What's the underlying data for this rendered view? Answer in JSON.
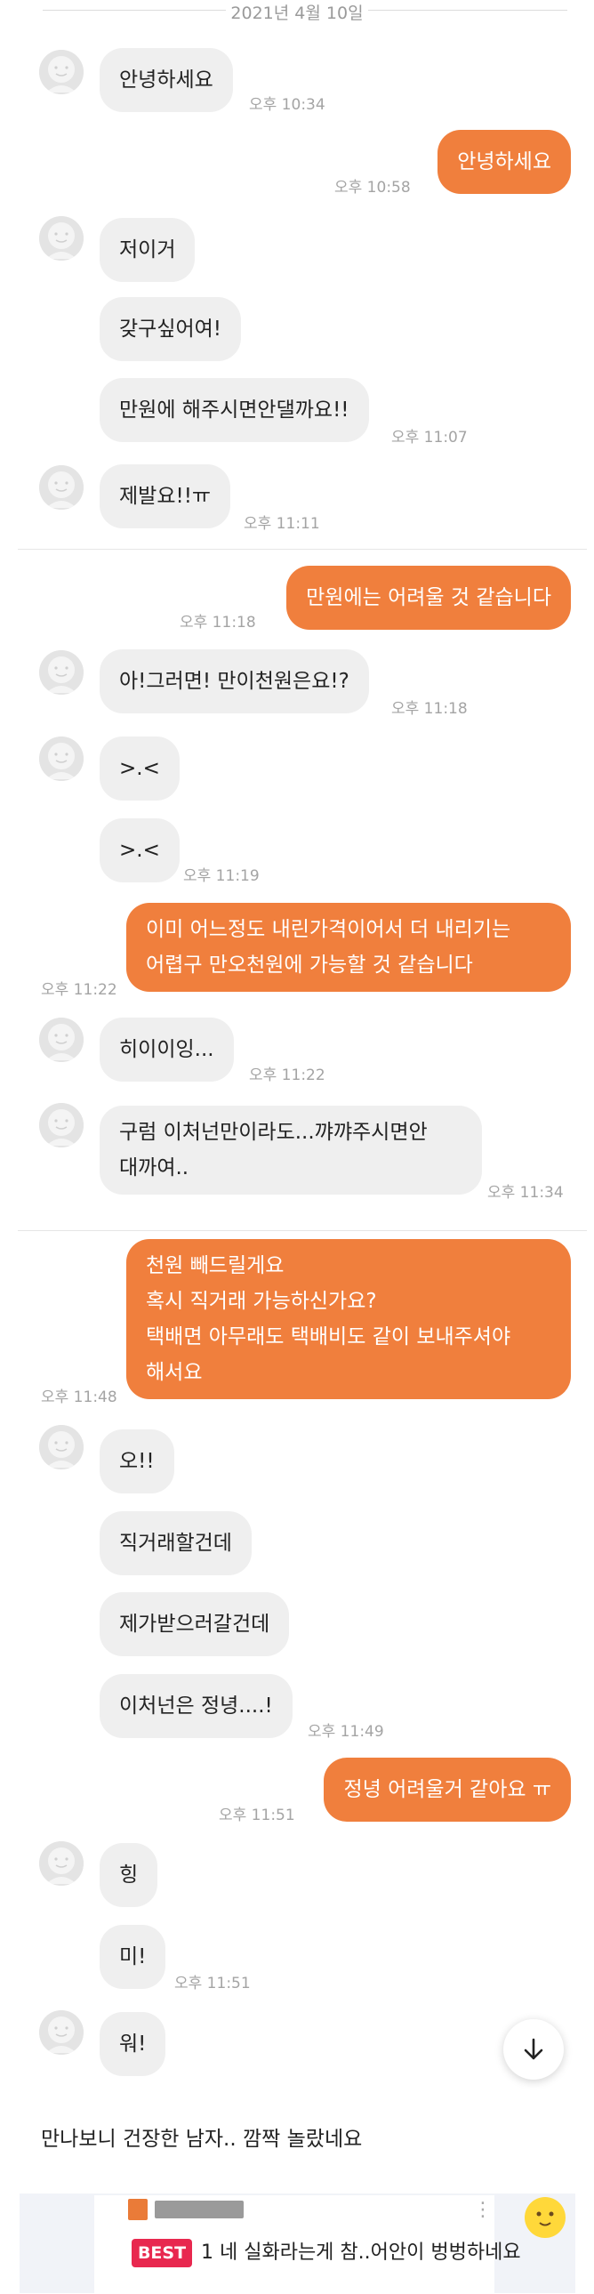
{
  "date_separator": "2021년 4월 10일",
  "messages": [
    {
      "text": "안녕하세요",
      "time": "오후 10:34"
    },
    {
      "text": "안녕하세요",
      "time": "오후 10:58"
    },
    {
      "text": "저이거"
    },
    {
      "text": "갖구싶어여!"
    },
    {
      "text": "만원에 해주시면안댈까요!!",
      "time": "오후 11:07"
    },
    {
      "text": "제발요!!ㅠ",
      "time": "오후 11:11"
    },
    {
      "text": "만원에는 어려울 것 같습니다",
      "time": "오후 11:18"
    },
    {
      "text": "아!그러면! 만이천원은요!?",
      "time": "오후 11:18"
    },
    {
      "text": ">.<"
    },
    {
      "text": ">.<",
      "time": "오후 11:19"
    },
    {
      "lines": [
        "이미 어느정도 내린가격이어서 더 내리기는",
        "어렵구 만오천원에 가능할 것 같습니다"
      ],
      "time": "오후 11:22"
    },
    {
      "text": "히이이잉...",
      "time": "오후 11:22"
    },
    {
      "lines": [
        "구럼  이처넌만이라도...꺄꺄주시면안",
        "대까여.."
      ],
      "time": "오후 11:34"
    },
    {
      "lines": [
        "천원 빼드릴게요",
        "혹시 직거래 가능하신가요?",
        "택배면 아무래도 택배비도 같이 보내주셔야",
        "해서요"
      ],
      "time": "오후 11:48"
    },
    {
      "text": "오!!"
    },
    {
      "text": "직거래할건데"
    },
    {
      "text": "제가받으러갈건데"
    },
    {
      "text": "이처넌은 정녕....!",
      "time": "오후 11:49"
    },
    {
      "text": "정녕 어려울거 같아요 ㅠ",
      "time": "오후 11:51"
    },
    {
      "text": "힝"
    },
    {
      "text": "미!",
      "time": "오후 11:51"
    },
    {
      "text": "워!"
    }
  ],
  "caption": "만나보니 건장한 남자.. 깜짝 놀랐네요",
  "best_post": {
    "badge": "BEST",
    "title": "1 네 실화라는게 참..어안이 벙벙하네요"
  },
  "icons": {
    "scroll": "arrow-down-icon",
    "avatar": "default-profile-icon",
    "more": "more-vertical-icon",
    "emoji": "emoji-face-icon"
  },
  "colors": {
    "outgoing_bubble": "#f07f3d",
    "incoming_bubble": "#efefef",
    "timestamp": "#a4a4a4",
    "best_badge": "#e8284f"
  }
}
